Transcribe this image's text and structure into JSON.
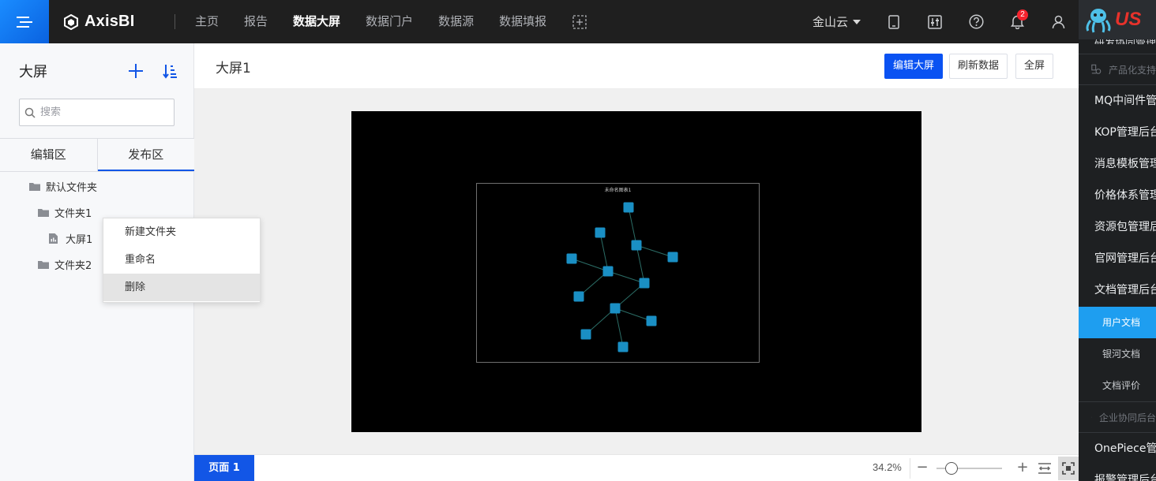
{
  "app": {
    "logo_text": "AxisBI"
  },
  "nav": [
    {
      "label": "主页",
      "active": false
    },
    {
      "label": "报告",
      "active": false
    },
    {
      "label": "数据大屏",
      "active": true
    },
    {
      "label": "数据门户",
      "active": false
    },
    {
      "label": "数据源",
      "active": false
    },
    {
      "label": "数据填报",
      "active": false
    }
  ],
  "header_right": {
    "tenant": "金山云",
    "notification_count": "2"
  },
  "sidebar": {
    "title": "大屏",
    "search_placeholder": "搜索",
    "tabs": [
      {
        "label": "编辑区",
        "active": false
      },
      {
        "label": "发布区",
        "active": true
      }
    ],
    "tree": {
      "default_folder": "默认文件夹",
      "folder1": "文件夹1",
      "screen1": "大屏1",
      "folder2": "文件夹2"
    }
  },
  "context_menu": {
    "new_folder": "新建文件夹",
    "rename": "重命名",
    "delete": "删除",
    "hovered": "delete"
  },
  "main": {
    "title": "大屏1",
    "edit_button": "编辑大屏",
    "refresh_button": "刷新数据",
    "fullscreen_button": "全屏",
    "graph_title": "未命名图表1"
  },
  "graph": {
    "node_color": "#1a8fc4",
    "edge_color": "#2b6d66",
    "nodes": 12,
    "edges": 11
  },
  "bottom": {
    "page_tab": "页面 1",
    "zoom": "34.2%",
    "zoom_fraction": 0.23
  },
  "right_panel": {
    "logo_text": "US",
    "cut_text": "研发协同管理平台",
    "groups": {
      "product": "产品化支持",
      "enterprise": "企业协同后台"
    },
    "items": {
      "mq": "MQ中间件管理",
      "kop": "KOP管理后台",
      "msg": "消息模板管理",
      "price": "价格体系管理",
      "resource": "资源包管理后台",
      "website": "官网管理后台",
      "doc": "文档管理后台",
      "onepiece": "OnePiece管理",
      "report": "报警管理后台"
    },
    "subs": {
      "user_doc": "用户文档",
      "yinhe": "银河文档",
      "review": "文档评价"
    }
  },
  "colors": {
    "accent": "#1256e6",
    "primary_button": "#0a52f2",
    "topbar": "#1f1f1f",
    "panel_active": "#1e9ef0"
  }
}
